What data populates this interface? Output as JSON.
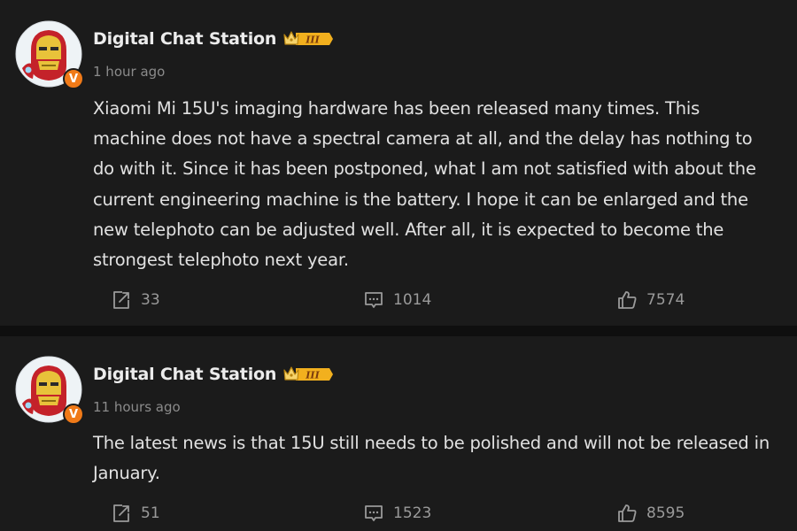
{
  "posts": [
    {
      "username": "Digital Chat Station",
      "rank_badge": "III",
      "verified_badge": "V",
      "timestamp": "1 hour ago",
      "content": "Xiaomi Mi 15U's imaging hardware has been released many times. This machine does not have a spectral camera at all, and the delay has nothing to do with it. Since it has been postponed, what I am not satisfied with about the current engineering machine is the battery. I hope it can be enlarged and the new telephoto can be adjusted well. After all, it is expected to become the strongest telephoto next year.",
      "shares": "33",
      "comments": "1014",
      "likes": "7574"
    },
    {
      "username": "Digital Chat Station",
      "rank_badge": "III",
      "verified_badge": "V",
      "timestamp": "11 hours ago",
      "content": "The latest news is that 15U still needs to be polished and will not be released in January.",
      "shares": "51",
      "comments": "1523",
      "likes": "8595"
    }
  ],
  "icons": {
    "share": "share-icon",
    "comment": "comment-icon",
    "like": "thumbs-up-icon",
    "crown": "crown-icon"
  },
  "colors": {
    "background": "#1b1b1b",
    "verified": "#f07a18",
    "rank_badge": "#f2b01e"
  }
}
